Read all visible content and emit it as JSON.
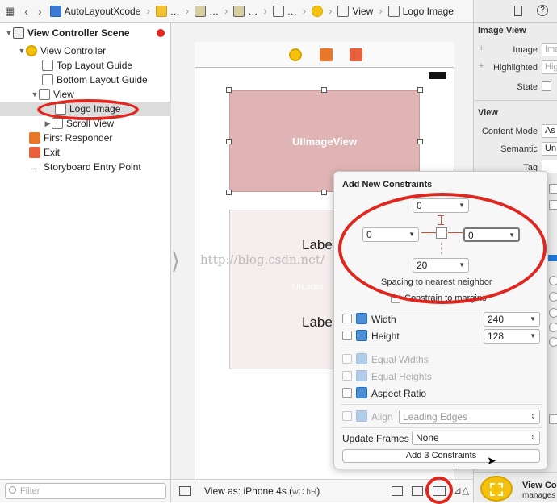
{
  "jumpbar": {
    "items": [
      "AutoLayoutXcode",
      "…",
      "…",
      "…",
      "…",
      "View",
      "Logo Image"
    ]
  },
  "outline": {
    "rows": [
      {
        "label": "View Controller Scene",
        "bold": true
      },
      {
        "label": "View Controller"
      },
      {
        "label": "Top Layout Guide"
      },
      {
        "label": "Bottom Layout Guide"
      },
      {
        "label": "View"
      },
      {
        "label": "Logo Image"
      },
      {
        "label": "Scroll View"
      },
      {
        "label": "First Responder"
      },
      {
        "label": "Exit"
      },
      {
        "label": "Storyboard Entry Point"
      }
    ],
    "filter_placeholder": "Filter"
  },
  "canvas": {
    "imageview_label": "UIImageView",
    "label1": "Label",
    "label2": "Label",
    "label_faint": "UILabel",
    "watermark": "http://blog.csdn.net/"
  },
  "bottombar": {
    "view_as": "View as: iPhone 4s (",
    "size_class": "wC hR",
    "close_paren": ")"
  },
  "inspector": {
    "section_image_view": "Image View",
    "image_label": "Image",
    "image_placeholder": "Image",
    "highlighted_label": "Highlighted",
    "highlighted_placeholder": "Highl",
    "state_label": "State",
    "section_view": "View",
    "content_mode_label": "Content Mode",
    "content_mode_value": "As",
    "semantic_label": "Semantic",
    "semantic_value": "Un",
    "tag_label": "Tag",
    "bottom_title": "View Co",
    "bottom_sub": "manages"
  },
  "popover": {
    "title": "Add New Constraints",
    "top_value": "0",
    "left_value": "0",
    "right_value": "0",
    "bottom_value": "20",
    "spacing_caption": "Spacing to nearest neighbor",
    "constrain_margins": "Constrain to margins",
    "width_label": "Width",
    "width_value": "240",
    "height_label": "Height",
    "height_value": "128",
    "equal_widths": "Equal Widths",
    "equal_heights": "Equal Heights",
    "aspect_ratio": "Aspect Ratio",
    "align_label": "Align",
    "align_value": "Leading Edges",
    "update_frames_label": "Update Frames",
    "update_frames_value": "None",
    "add_button": "Add 3 Constraints"
  },
  "colors": {
    "annotation_red": "#e0271f",
    "imageview_fill": "#e0b4b4",
    "accent_blue": "#4d8fd6"
  }
}
